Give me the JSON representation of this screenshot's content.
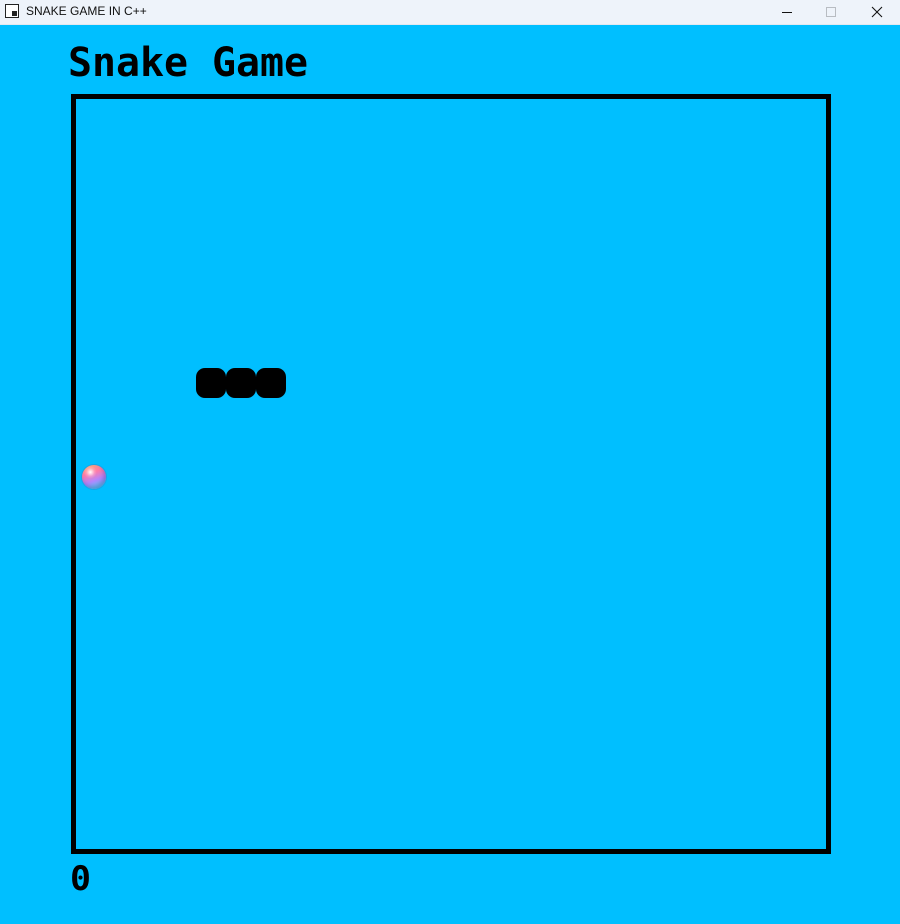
{
  "window": {
    "title": "SNAKE GAME IN C++",
    "background_color": "#00bfff"
  },
  "game": {
    "title": "Snake Game",
    "score": "0",
    "snake_color": "#000000",
    "snake_length": 3,
    "border_color": "#000000"
  }
}
